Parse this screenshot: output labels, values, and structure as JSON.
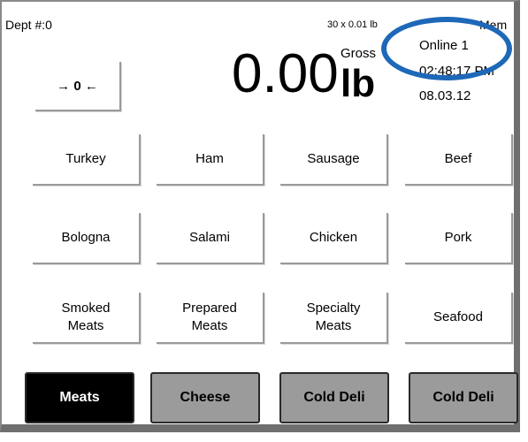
{
  "header": {
    "dept": "Dept #:0",
    "capacity": "30 x 0.01 lb",
    "mem": "Mem"
  },
  "zero_button": {
    "label": "→ 0 ←"
  },
  "display": {
    "weight": "0.00",
    "mode": "Gross",
    "unit": "lb"
  },
  "status": {
    "online": "Online 1",
    "time": "02:48:17 PM",
    "date": "08.03.12"
  },
  "annotation": {
    "color": "#1e68b8"
  },
  "keys": [
    [
      "Turkey",
      "Ham",
      "Sausage",
      "Beef"
    ],
    [
      "Bologna",
      "Salami",
      "Chicken",
      "Pork"
    ],
    [
      "Smoked\nMeats",
      "Prepared\nMeats",
      "Specialty\nMeats",
      "Seafood"
    ]
  ],
  "key_labels": {
    "turkey": "Turkey",
    "ham": "Ham",
    "sausage": "Sausage",
    "beef": "Beef",
    "bologna": "Bologna",
    "salami": "Salami",
    "chicken": "Chicken",
    "pork": "Pork",
    "smoked_1": "Smoked",
    "smoked_2": "Meats",
    "prepared_1": "Prepared",
    "prepared_2": "Meats",
    "specialty_1": "Specialty",
    "specialty_2": "Meats",
    "seafood": "Seafood"
  },
  "tabs": [
    {
      "label": "Meats",
      "active": true
    },
    {
      "label": "Cheese",
      "active": false
    },
    {
      "label": "Cold Deli",
      "active": false
    },
    {
      "label": "Cold Deli",
      "active": false
    }
  ]
}
